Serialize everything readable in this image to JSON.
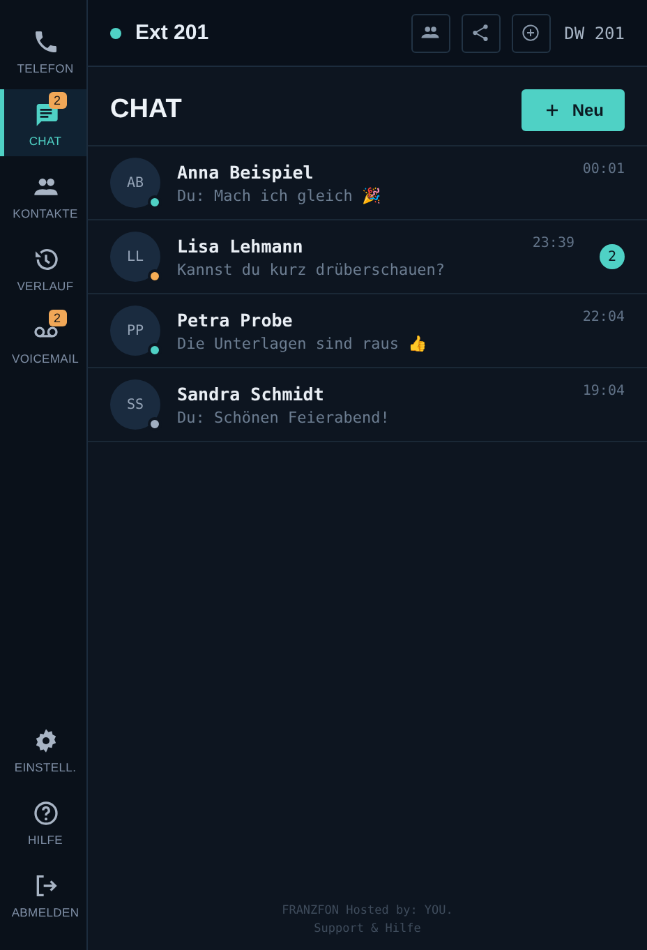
{
  "sidebar": {
    "items": [
      {
        "label": "TELEFON",
        "selected": false
      },
      {
        "label": "CHAT",
        "selected": true,
        "badge": "2"
      },
      {
        "label": "KONTAKTE",
        "selected": false
      },
      {
        "label": "VERLAUF",
        "selected": false
      },
      {
        "label": "VOICEMAIL",
        "selected": false,
        "badge": "2"
      }
    ],
    "bottom_items": [
      {
        "label": "EINSTELL."
      },
      {
        "label": "HILFE"
      },
      {
        "label": "ABMELDEN"
      }
    ]
  },
  "header": {
    "online": true,
    "extension": "Ext 201",
    "dw": "DW 201"
  },
  "chat": {
    "title": "CHAT",
    "new_button": "Neu",
    "conversations": [
      {
        "initials": "AB",
        "name": "Anna Beispiel",
        "preview": "Du: Mach ich gleich 🎉",
        "time": "00:01",
        "color": "#4fd1c5"
      },
      {
        "initials": "LL",
        "name": "Lisa Lehmann",
        "preview": "Kannst du kurz drüberschauen?",
        "time": "23:39",
        "color": "#f6ad55",
        "unread": "2"
      },
      {
        "initials": "PP",
        "name": "Petra Probe",
        "preview": "Die Unterlagen sind raus 👍",
        "time": "22:04",
        "color": "#4fd1c5"
      },
      {
        "initials": "SS",
        "name": "Sandra Schmidt",
        "preview": "Du: Schönen Feierabend!",
        "time": "19:04",
        "color": "#a0aec0"
      }
    ]
  },
  "footer": {
    "line_1": "FRANZFON Hosted by: YOU.",
    "line_2": "Support & Hilfe"
  }
}
